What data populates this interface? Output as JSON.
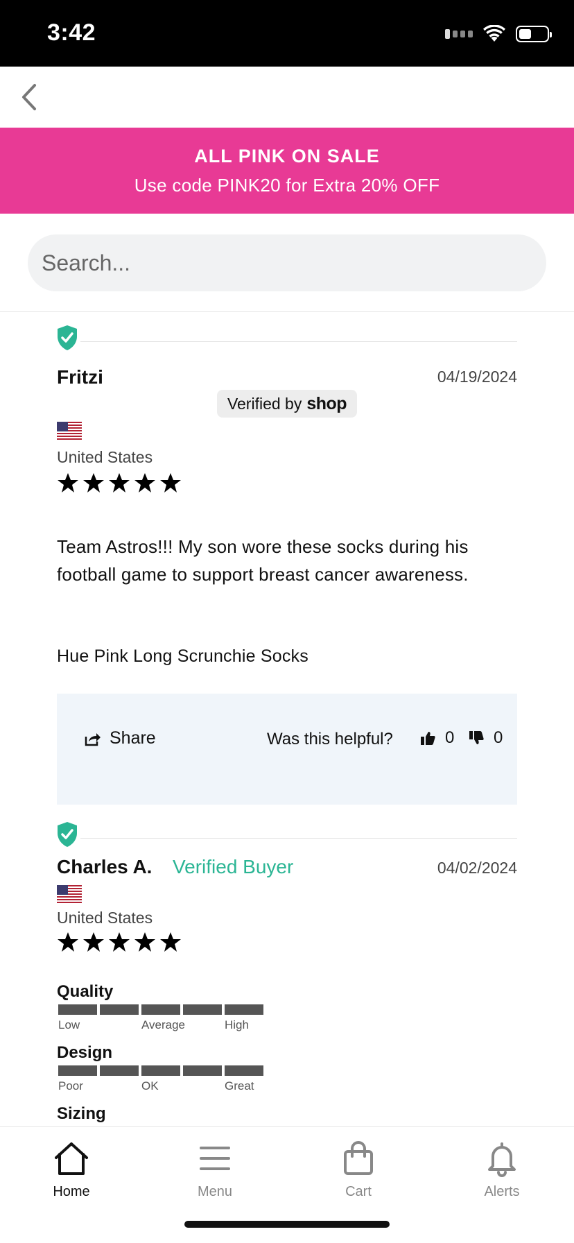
{
  "status_bar": {
    "time": "3:42"
  },
  "promo": {
    "title": "ALL PINK ON SALE",
    "subtitle": "Use code PINK20 for Extra 20% OFF",
    "background": "#e83a95"
  },
  "search": {
    "placeholder": "Search..."
  },
  "reviews": [
    {
      "name": "Fritzi",
      "date": "04/19/2024",
      "verified_by_prefix": "Verified by",
      "verified_by_brand": "shop",
      "country": "United States",
      "rating": 5,
      "body": "Team Astros!!! My son wore these socks during his football game to support breast cancer awareness.",
      "product": "Hue Pink Long Scrunchie Socks",
      "share_label": "Share",
      "helpful_label": "Was this helpful?",
      "upvotes": "0",
      "downvotes": "0"
    },
    {
      "name": "Charles A.",
      "badge": "Verified Buyer",
      "date": "04/02/2024",
      "country": "United States",
      "rating": 5,
      "attributes": [
        {
          "label": "Quality",
          "scale": [
            "Low",
            "Average",
            "High"
          ]
        },
        {
          "label": "Design",
          "scale": [
            "Poor",
            "OK",
            "Great"
          ]
        },
        {
          "label": "Sizing"
        }
      ]
    }
  ],
  "tabs": [
    {
      "label": "Home",
      "icon": "home-icon",
      "active": true
    },
    {
      "label": "Menu",
      "icon": "menu-icon",
      "active": false
    },
    {
      "label": "Cart",
      "icon": "cart-icon",
      "active": false
    },
    {
      "label": "Alerts",
      "icon": "bell-icon",
      "active": false
    }
  ],
  "colors": {
    "accent_pink": "#e83a95",
    "verified_green": "#2bb594",
    "action_box": "#f0f5fa"
  }
}
